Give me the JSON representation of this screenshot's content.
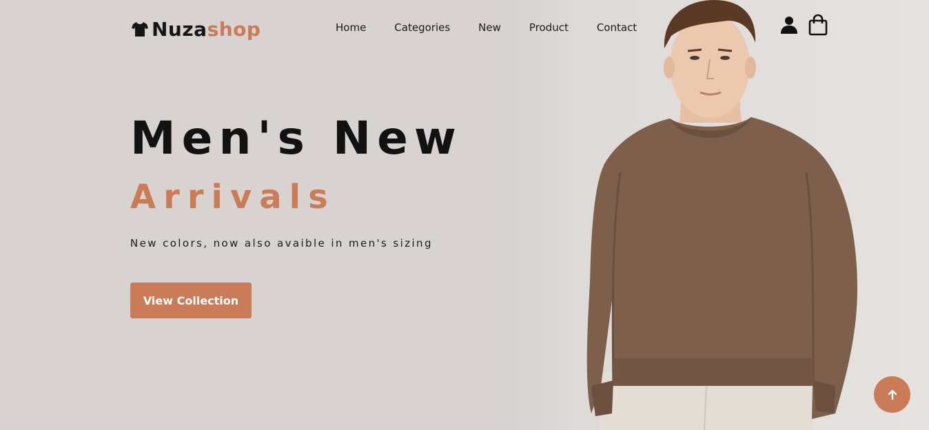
{
  "brand": {
    "part1": "Nuza",
    "part2": "shop",
    "accent_color": "#c97c57",
    "icon": "tshirt-icon"
  },
  "nav": {
    "items": [
      {
        "label": "Home"
      },
      {
        "label": "Categories"
      },
      {
        "label": "New"
      },
      {
        "label": "Product"
      },
      {
        "label": "Contact"
      }
    ]
  },
  "header_icons": {
    "account": "user-icon",
    "cart": "shopping-bag-icon"
  },
  "hero": {
    "title_line1": "Men's New",
    "title_line2": "Arrivals",
    "subtitle": "New colors, now also avaible in men's sizing",
    "cta_label": "View Collection",
    "image": "male-model-brown-sweater"
  },
  "scroll_top": {
    "icon": "arrow-up-icon"
  },
  "colors": {
    "background": "#d8d3d0",
    "text": "#121212",
    "accent": "#c97c57"
  }
}
